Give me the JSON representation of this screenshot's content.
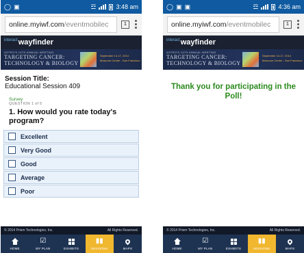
{
  "left_screen": {
    "status": {
      "time": "3:48 am"
    },
    "browser": {
      "url_host": "online.myiwf.com",
      "url_path": "/eventmobilec",
      "tab_count": "1"
    },
    "brand": {
      "logo": "wayfinder",
      "logo_prefix": "interact"
    },
    "banner": {
      "kicker": "ASTRO'S 14TH ANNUAL MEETING",
      "line1": "TARGETING CANCER:",
      "line2": "TECHNOLOGY & BIOLOGY",
      "date_line1": "September 14-17, 2014",
      "date_line2": "Moscone Center - San Francisco"
    },
    "session": {
      "title_label": "Session Title:",
      "name": "Educational Session 409"
    },
    "survey": {
      "label": "Survey",
      "question_count": "QUESTION 1 of 5",
      "question": "1. How would you rate today's program?",
      "options": [
        "Excellent",
        "Very Good",
        "Good",
        "Average",
        "Poor"
      ]
    },
    "footer": {
      "copyright": "© 2014 Prism Technologies, Inc.",
      "rights": "All Rights Reserved."
    },
    "tabs": [
      {
        "label": "HOME",
        "icon": "home-icon"
      },
      {
        "label": "MY PLAN",
        "icon": "checklist-icon"
      },
      {
        "label": "EXHIBITS",
        "icon": "grid-icon"
      },
      {
        "label": "SESSIONS",
        "icon": "sessions-icon",
        "active": true
      },
      {
        "label": "MAPS",
        "icon": "map-pin-icon"
      }
    ]
  },
  "right_screen": {
    "status": {
      "time": "4:36 am"
    },
    "browser": {
      "url_host": "online.myiwf.com",
      "url_path": "/eventmobilec",
      "tab_count": "1"
    },
    "brand": {
      "logo": "wayfinder",
      "logo_prefix": "interact"
    },
    "banner": {
      "kicker": "ASTRO'S 14TH ANNUAL MEETING",
      "line1": "TARGETING CANCER:",
      "line2": "TECHNOLOGY & BIOLOGY",
      "date_line1": "September 14-17, 2014",
      "date_line2": "Moscone Center - San Francisco"
    },
    "thanks": "Thank you for participating in the Poll!",
    "footer": {
      "copyright": "© 2014 Prism Technologies, Inc.",
      "rights": "All Rights Reserved."
    },
    "tabs": [
      {
        "label": "HOME",
        "icon": "home-icon"
      },
      {
        "label": "MY PLAN",
        "icon": "checklist-icon"
      },
      {
        "label": "EXHIBITS",
        "icon": "grid-icon"
      },
      {
        "label": "SESSIONS",
        "icon": "sessions-icon",
        "active": true
      },
      {
        "label": "MAPS",
        "icon": "map-pin-icon"
      }
    ]
  },
  "colors": {
    "status_bar": "#0f5aa0",
    "tab_bar": "#1e3352",
    "active_tab": "#f0b72f",
    "thanks_text": "#2b8a1e",
    "option_bg": "#e9f1fa"
  }
}
